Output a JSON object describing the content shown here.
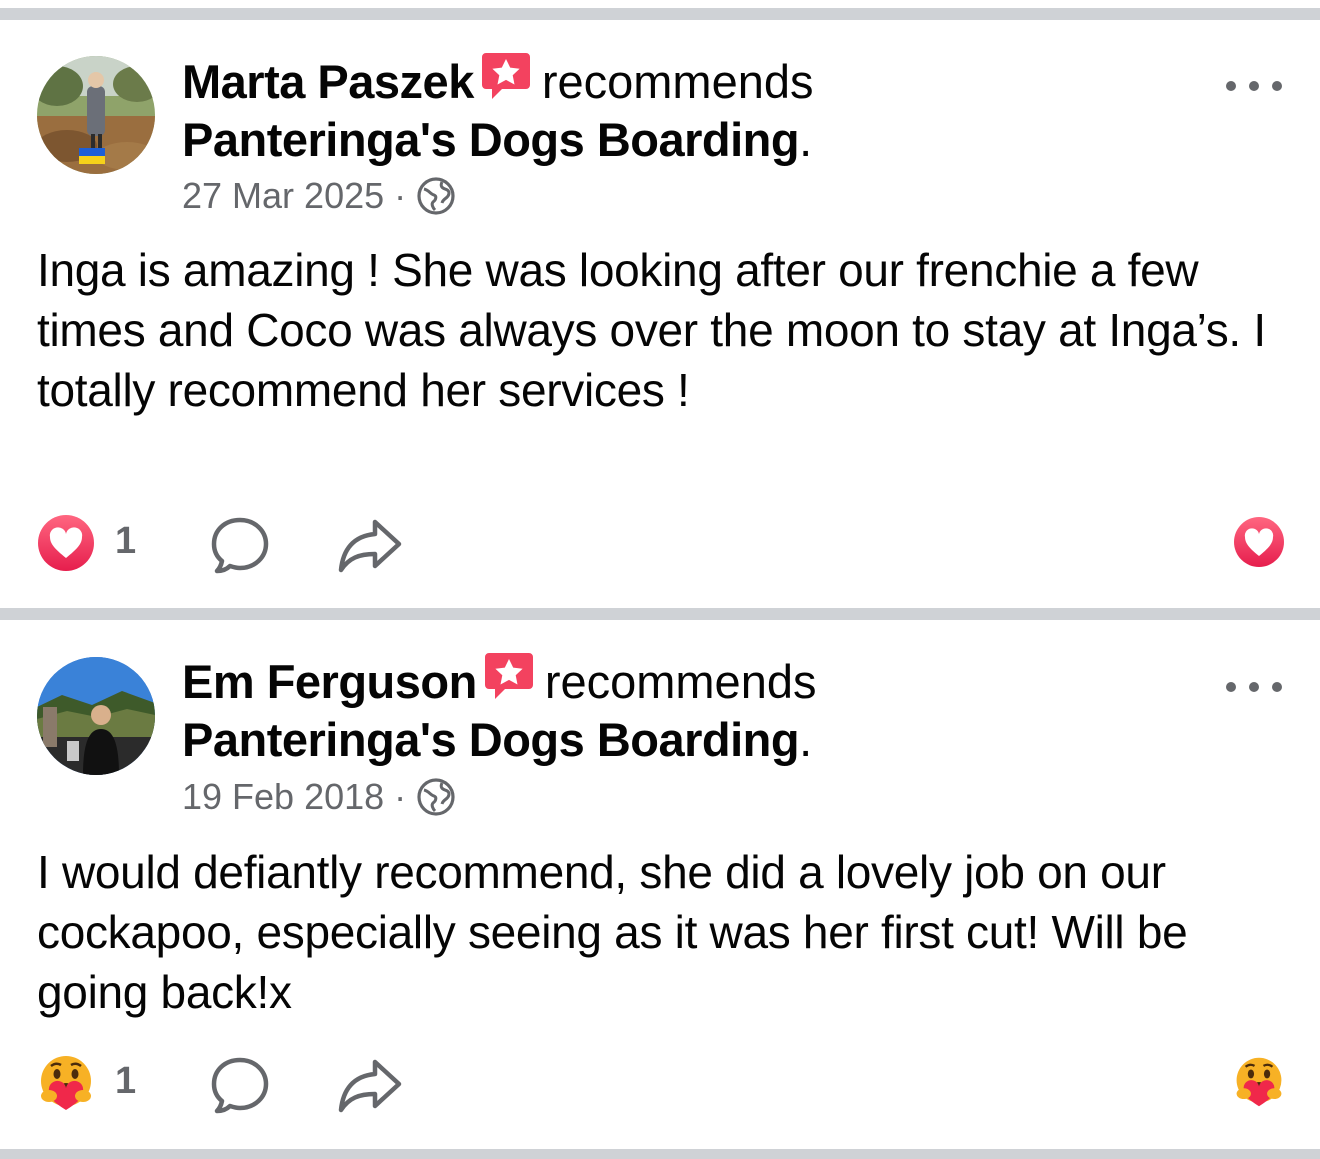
{
  "posts": [
    {
      "author": "Marta Paszek",
      "verb": "recommends",
      "page_name": "Panteringa's Dogs Boarding",
      "page_suffix": ".",
      "date": "27 Mar 2025",
      "separator": "·",
      "privacy_icon": "globe-icon",
      "text": "Inga is amazing ! She was looking after our frenchie a few times and Coco was always over the moon to stay at Inga’s. I totally recommend her services !",
      "reaction_type": "love",
      "reaction_icon": "heart-reaction-icon",
      "reaction_count": "1"
    },
    {
      "author": "Em Ferguson",
      "verb": "recommends",
      "page_name": "Panteringa's Dogs Boarding",
      "page_suffix": ".",
      "date": "19 Feb 2018",
      "separator": "·",
      "privacy_icon": "globe-icon",
      "text": "I would defiantly recommend, she did a lovely job on our cockapoo, especially seeing as it was her first cut! Will be going back!x",
      "reaction_type": "care",
      "reaction_icon": "care-reaction-icon",
      "reaction_count": "1"
    }
  ],
  "colors": {
    "text": "#050505",
    "secondary": "#65676b",
    "divider": "#cfd2d6",
    "love": "#f0284a",
    "care_face": "#f7b125",
    "recommend_badge": "#f3425f"
  }
}
